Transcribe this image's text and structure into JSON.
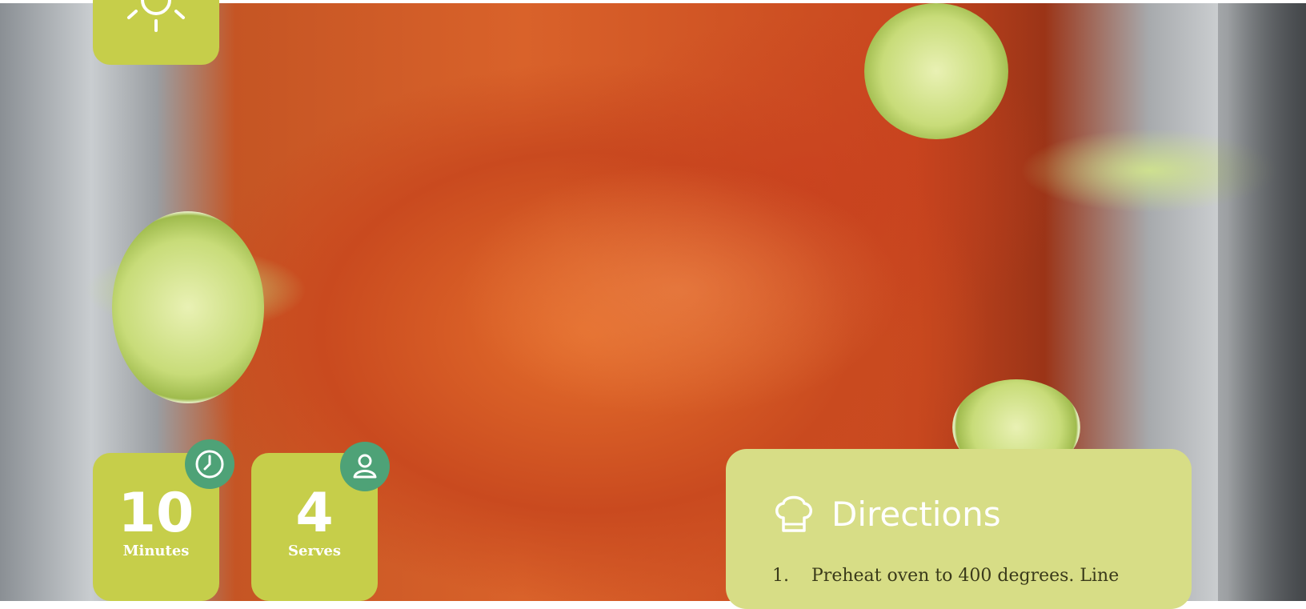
{
  "stats": {
    "time": {
      "value": "10",
      "label": "Minutes",
      "icon": "clock-icon"
    },
    "serves": {
      "value": "4",
      "label": "Serves",
      "icon": "person-icon"
    }
  },
  "top_tile": {
    "icon": "sun-icon"
  },
  "hero_image": {
    "alt": "Glazed baked salmon fillet with lime slices and cilantro on foil"
  },
  "directions": {
    "title": "Directions",
    "icon": "chef-hat-icon",
    "steps": [
      {
        "num": "1.",
        "text": "Preheat oven to 400 degrees. Line"
      }
    ]
  },
  "colors": {
    "tile": "#c6ce4a",
    "badge": "#4ea277",
    "directions_panel": "#d7dd86"
  }
}
